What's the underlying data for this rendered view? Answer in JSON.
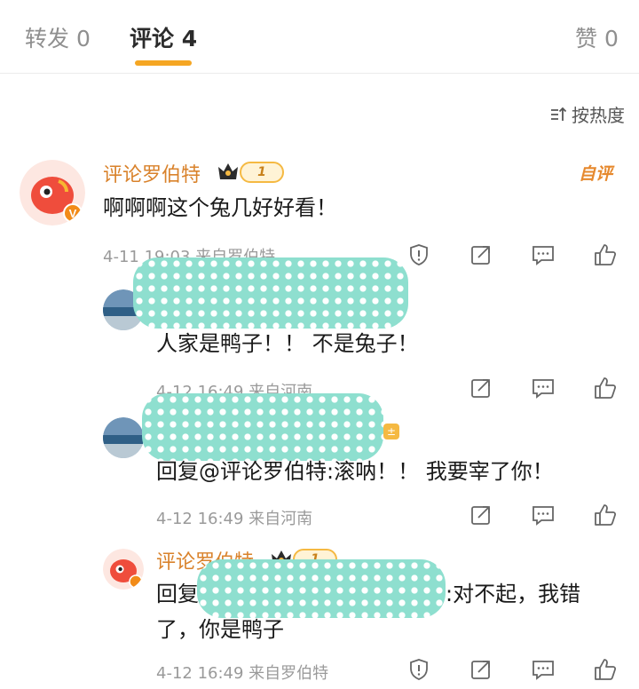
{
  "tabs": {
    "repost": "转发 0",
    "comments": "评论 4",
    "likes": "赞 0"
  },
  "sort": {
    "label": "按热度"
  },
  "comments": [
    {
      "username": "评论罗伯特",
      "level": "1",
      "author_tag": "自评",
      "text": "啊啊啊这个兔几好好看！",
      "meta": "4-11 19:03  来自罗伯特"
    }
  ],
  "replies": [
    {
      "text": "人家是鸭子！！ 不是兔子！",
      "meta": "4-12 16:49  来自河南"
    },
    {
      "text": "回复@评论罗伯特:滚呐！！ 我要宰了你！",
      "meta": "4-12 16:49  来自河南"
    },
    {
      "username": "评论罗伯特",
      "level": "1",
      "text_prefix": "回复",
      "text_suffix": ":对不起，我错",
      "text_line2": "了，你是鸭子",
      "meta": "4-12 16:49  来自罗伯特"
    }
  ],
  "colors": {
    "accent": "#f5a623",
    "username": "#d9822b",
    "mask": "#8edfcf"
  },
  "icons": [
    "sort-icon",
    "shield-icon",
    "share-icon",
    "reply-icon",
    "like-icon",
    "crown-icon"
  ]
}
